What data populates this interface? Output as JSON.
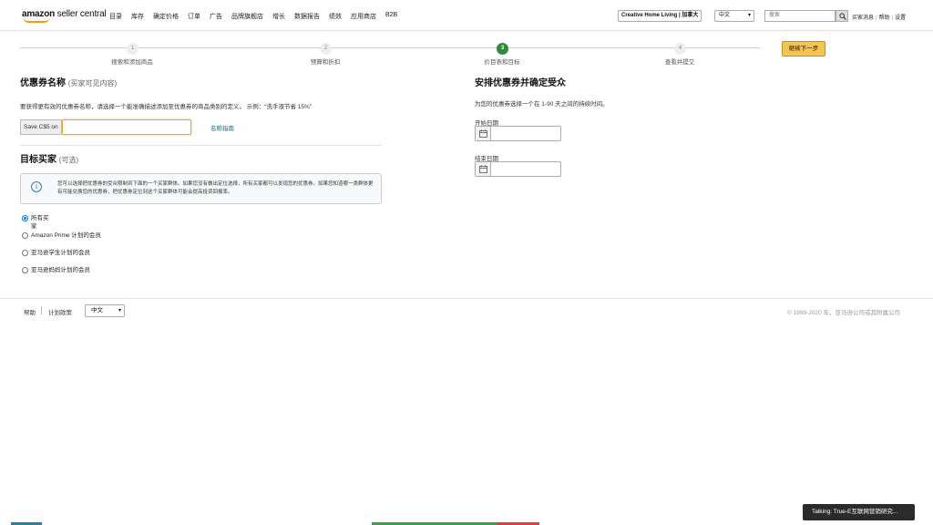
{
  "logo": {
    "text": "amazon",
    "suffix": "seller central"
  },
  "nav": {
    "menu": [
      "目录",
      "库存",
      "确定价格",
      "订单",
      "广告",
      "品牌旗舰店",
      "增长",
      "数据报告",
      "绩效",
      "应用商店",
      "B2B"
    ],
    "store": "Creative Home Living | 加拿大",
    "language": "中文",
    "search_placeholder": "搜索",
    "links": {
      "messages": "买家消息",
      "help": "帮助",
      "settings": "设置"
    }
  },
  "progress": {
    "steps": [
      {
        "num": "1",
        "label": "搜索和添加商品"
      },
      {
        "num": "2",
        "label": "预算和折扣"
      },
      {
        "num": "3",
        "label": "价目表和目标"
      },
      {
        "num": "4",
        "label": "查看并提交"
      }
    ],
    "active_step": 3,
    "next_button": "继续下一步"
  },
  "coupon_name": {
    "title": "优惠券名称",
    "subtitle": "(买家可见内容)",
    "description": "要获得更有效的优惠券名称，请选择一个能准确描述添加至优惠券的商品类别的定义。 示例：“洗手液节省 15%”",
    "prefix": "Save C$5 on",
    "input_value": "",
    "guide_link": "名称指南"
  },
  "target": {
    "title": "目标买家",
    "subtitle": "(可选)",
    "info": "您可以选择把优惠券的受众限制到下面的一个买家群体。如果您没有做出定位选择，所有买家都可以发现您的优惠券。如果您知道哪一类群体更有可能兑换您的优惠券，把优惠券定位到这个买家群体可能会提高投资回报率。",
    "options": [
      "所有买家",
      "Amazon Prime 计划的会员",
      "亚马逊学生计划的会员",
      "亚马逊妈妈计划的会员"
    ],
    "selected": 0
  },
  "schedule": {
    "title": "安排优惠券并确定受众",
    "description": "为您的优惠券选择一个在 1-90 天之间的持续时间。",
    "start_label": "开始日期",
    "start_value": "",
    "end_label": "结束日期",
    "end_value": ""
  },
  "footer": {
    "help": "帮助",
    "policy": "计划政策",
    "language": "中文",
    "copyright": "© 1999-2020 年，亚马逊公司或其附属公司"
  },
  "talking": "Talking: True-E互联网营销研究..."
}
